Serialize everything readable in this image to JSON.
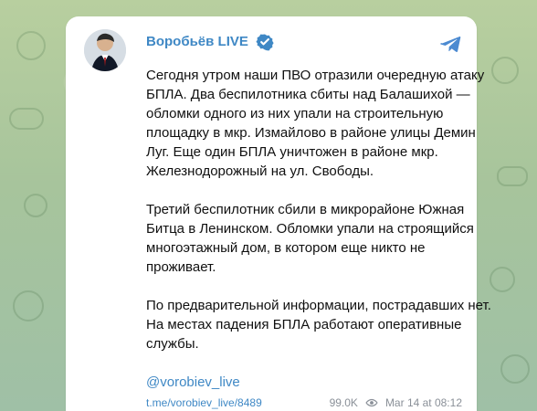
{
  "post": {
    "channel_name": "Воробьёв LIVE",
    "verified_icon": "verified-icon",
    "share_icon": "telegram-share-icon",
    "paragraphs": [
      "Сегодня утром наши ПВО отразили очередную атаку\nБПЛА. Два беспилотника сбиты над Балашихой —\nобломки одного из них упали на строительную\nплощадку в мкр. Измайлово в районе улицы Демин\nЛуг. Еще один БПЛА уничтожен в районе мкр.\nЖелезнодорожный на ул. Свободы.",
      "Третий беспилотник сбили в микрорайоне Южная\nБитца в Ленинском. Обломки упали на строящийся\nмногоэтажный дом, в котором еще никто не\nпроживает.",
      "По предварительной информации, пострадавших нет.\nНа местах падения БПЛА работают оперативные\nслужбы."
    ],
    "handle": "@vorobiev_live",
    "post_link": "t.me/vorobiev_live/8489",
    "views": "99.0K",
    "views_icon": "eye-icon",
    "timestamp": "Mar 14 at 08:12",
    "accent_color": "#3f88c5"
  }
}
